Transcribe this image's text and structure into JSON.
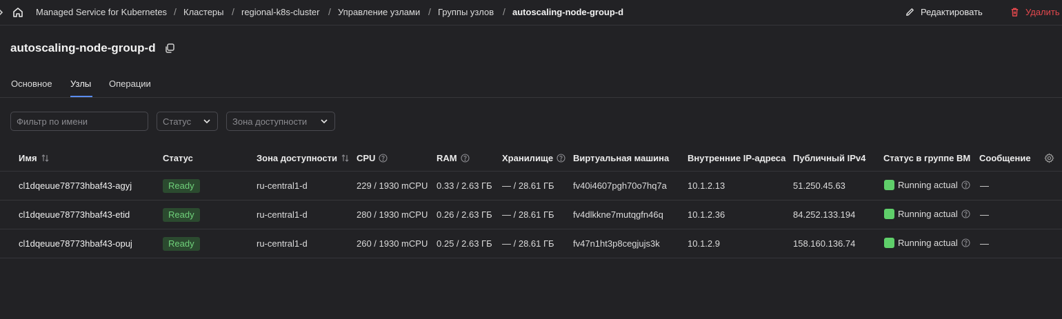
{
  "breadcrumbs": [
    "Managed Service for Kubernetes",
    "Кластеры",
    "regional-k8s-cluster",
    "Управление узлами",
    "Группы узлов",
    "autoscaling-node-group-d"
  ],
  "header": {
    "edit_label": "Редактировать",
    "delete_label": "Удалить"
  },
  "page_title": "autoscaling-node-group-d",
  "tabs": [
    "Основное",
    "Узлы",
    "Операции"
  ],
  "active_tab": "Узлы",
  "filters": {
    "name_placeholder": "Фильтр по имени",
    "status_label": "Статус",
    "zone_label": "Зона доступности"
  },
  "table": {
    "columns": [
      "Имя",
      "Статус",
      "Зона доступности",
      "CPU",
      "RAM",
      "Хранилище",
      "Виртуальная машина",
      "Внутренние IP-адреса",
      "Публичный IPv4",
      "Статус в группе ВМ",
      "Сообщение"
    ],
    "rows": [
      {
        "name": "cl1dqeuue78773hbaf43-agyj",
        "status": "Ready",
        "zone": "ru-central1-d",
        "cpu": "229 / 1930 mCPU",
        "ram": "0.33 / 2.63 ГБ",
        "storage": "— / 28.61 ГБ",
        "vm": "fv40i4607pgh70o7hq7a",
        "internal_ip": "10.1.2.13",
        "public_ip": "51.250.45.63",
        "vm_status": "Running actual",
        "message": "—"
      },
      {
        "name": "cl1dqeuue78773hbaf43-etid",
        "status": "Ready",
        "zone": "ru-central1-d",
        "cpu": "280 / 1930 mCPU",
        "ram": "0.26 / 2.63 ГБ",
        "storage": "— / 28.61 ГБ",
        "vm": "fv4dlkkne7mutqgfn46q",
        "internal_ip": "10.1.2.36",
        "public_ip": "84.252.133.194",
        "vm_status": "Running actual",
        "message": "—"
      },
      {
        "name": "cl1dqeuue78773hbaf43-opuj",
        "status": "Ready",
        "zone": "ru-central1-d",
        "cpu": "260 / 1930 mCPU",
        "ram": "0.25 / 2.63 ГБ",
        "storage": "— / 28.61 ГБ",
        "vm": "fv47n1ht3p8cegjujs3k",
        "internal_ip": "10.1.2.9",
        "public_ip": "158.160.136.74",
        "vm_status": "Running actual",
        "message": "—"
      }
    ]
  },
  "colors": {
    "background": "#222225",
    "accent": "#5b8def",
    "danger": "#e5484d",
    "ready_badge_bg": "#2b4a2f",
    "ready_badge_text": "#6fd07a",
    "running_square": "#5fcf6a"
  },
  "icons": [
    "sidebar-toggle-icon",
    "home-icon",
    "pencil-icon",
    "trash-icon",
    "copy-icon",
    "chevron-down-icon",
    "sort-icon",
    "help-circle-icon",
    "gear-icon"
  ]
}
